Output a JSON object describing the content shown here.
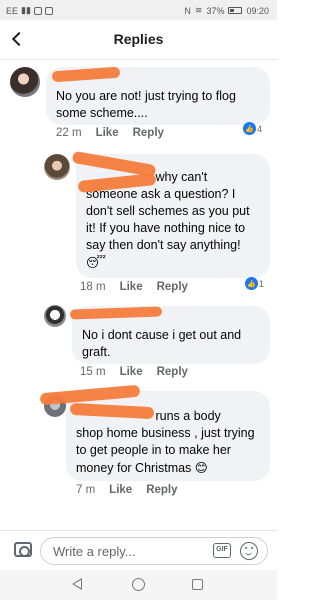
{
  "status_bar": {
    "carrier": "EE",
    "battery": "37%",
    "time": "09:20"
  },
  "header": {
    "title": "Replies"
  },
  "replies": [
    {
      "text": "No you are not! just trying to flog some scheme....",
      "time": "22 m",
      "like_label": "Like",
      "reply_label": "Reply",
      "reaction_count": "4"
    },
    {
      "text_line1": "why can't",
      "text_rest": "someone ask a question?  I don't sell schemes as you put it! If you have nothing nice to say then don't say anything!",
      "emoji": "😴",
      "time": "18 m",
      "like_label": "Like",
      "reply_label": "Reply",
      "reaction_count": "1"
    },
    {
      "text": "No i dont cause i get out and graft.",
      "time": "15 m",
      "like_label": "Like",
      "reply_label": "Reply"
    },
    {
      "text_line1": "runs a body",
      "text_rest": "shop home business , just trying to get people in to make her money for Christmas",
      "emoji": "😊",
      "time": "7 m",
      "like_label": "Like",
      "reply_label": "Reply"
    }
  ],
  "composer": {
    "placeholder": "Write a reply...",
    "gif_label": "GIF"
  },
  "icons": {
    "back": "chevron-left-icon",
    "camera": "camera-icon",
    "gif": "gif-icon",
    "emoji": "smiley-icon"
  },
  "colors": {
    "like_blue": "#1877f2",
    "bubble": "#f0f2f5",
    "redaction": "#f57c3c"
  }
}
